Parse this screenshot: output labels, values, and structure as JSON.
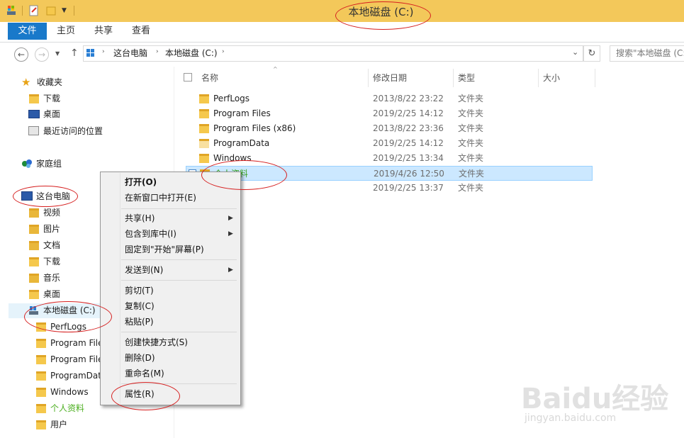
{
  "window": {
    "title": "本地磁盘 (C:)"
  },
  "ribbon": {
    "tabs": [
      "文件",
      "主页",
      "共享",
      "查看"
    ]
  },
  "address": {
    "path": [
      "这台电脑",
      "本地磁盘 (C:)"
    ],
    "search_placeholder": "搜索\"本地磁盘 (C:)\""
  },
  "nav": {
    "favorites": {
      "label": "收藏夹",
      "items": [
        "下载",
        "桌面",
        "最近访问的位置"
      ]
    },
    "homegroup": "家庭组",
    "thispc": {
      "label": "这台电脑",
      "items": [
        "视频",
        "图片",
        "文档",
        "下载",
        "音乐",
        "桌面"
      ]
    },
    "drive": {
      "label": "本地磁盘 (C:)",
      "items": [
        "PerfLogs",
        "Program File",
        "Program File",
        "ProgramDat",
        "Windows",
        "个人资料",
        "用户"
      ]
    }
  },
  "columns": [
    "名称",
    "修改日期",
    "类型",
    "大小"
  ],
  "files": [
    {
      "name": "PerfLogs",
      "date": "2013/8/22 23:22",
      "type": "文件夹"
    },
    {
      "name": "Program Files",
      "date": "2019/2/25 14:12",
      "type": "文件夹"
    },
    {
      "name": "Program Files (x86)",
      "date": "2013/8/22 23:36",
      "type": "文件夹"
    },
    {
      "name": "ProgramData",
      "date": "2019/2/25 14:12",
      "type": "文件夹"
    },
    {
      "name": "Windows",
      "date": "2019/2/25 13:34",
      "type": "文件夹"
    },
    {
      "name": "个人资料",
      "date": "2019/4/26 12:50",
      "type": "文件夹"
    },
    {
      "name": "",
      "date": "2019/2/25 13:37",
      "type": "文件夹"
    }
  ],
  "context_menu": {
    "open": "打开(O)",
    "open_new": "在新窗口中打开(E)",
    "share": "共享(H)",
    "include": "包含到库中(I)",
    "pin": "固定到\"开始\"屏幕(P)",
    "sendto": "发送到(N)",
    "cut": "剪切(T)",
    "copy": "复制(C)",
    "paste": "粘贴(P)",
    "shortcut": "创建快捷方式(S)",
    "delete": "删除(D)",
    "rename": "重命名(M)",
    "properties": "属性(R)"
  },
  "watermark": {
    "logo": "Baidu经验",
    "url": "jingyan.baidu.com"
  },
  "colors": {
    "titlebar": "#f3c85a",
    "accent": "#1979ca",
    "selection": "#cce8ff",
    "annotation": "#d62020"
  }
}
